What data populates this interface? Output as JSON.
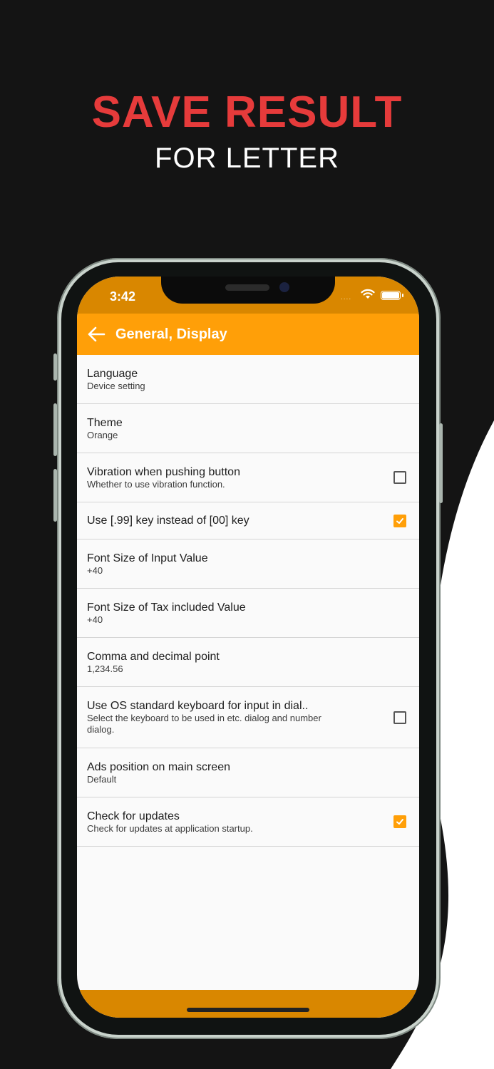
{
  "promo": {
    "headline": "SAVE RESULT",
    "subline": "FOR LETTER"
  },
  "status_bar": {
    "time": "3:42",
    "signal": "....",
    "icons": [
      "wifi-icon",
      "battery-icon"
    ]
  },
  "app_bar": {
    "title": "General, Display",
    "back_icon": "arrow-left-icon"
  },
  "settings": [
    {
      "title": "Language",
      "subtitle": "Device setting"
    },
    {
      "title": "Theme",
      "subtitle": "Orange"
    },
    {
      "title": "Vibration when pushing button",
      "subtitle": "Whether to use vibration function.",
      "checked": false
    },
    {
      "title": "Use [.99] key instead of [00] key",
      "checked": true
    },
    {
      "title": "Font Size of Input Value",
      "subtitle": "+40"
    },
    {
      "title": "Font Size of Tax included Value",
      "subtitle": "+40"
    },
    {
      "title": "Comma and decimal point",
      "subtitle": "1,234.56"
    },
    {
      "title": "Use OS standard keyboard for input in dial..",
      "subtitle": "Select the keyboard to be used in etc. dialog and number dialog.",
      "checked": false
    },
    {
      "title": "Ads position on main screen",
      "subtitle": "Default"
    },
    {
      "title": "Check for updates",
      "subtitle": "Check for updates at application startup.",
      "checked": true
    }
  ],
  "colors": {
    "accent": "#ff9f08",
    "status_bar": "#d98700",
    "headline": "#e63b3b",
    "background": "#141414"
  }
}
